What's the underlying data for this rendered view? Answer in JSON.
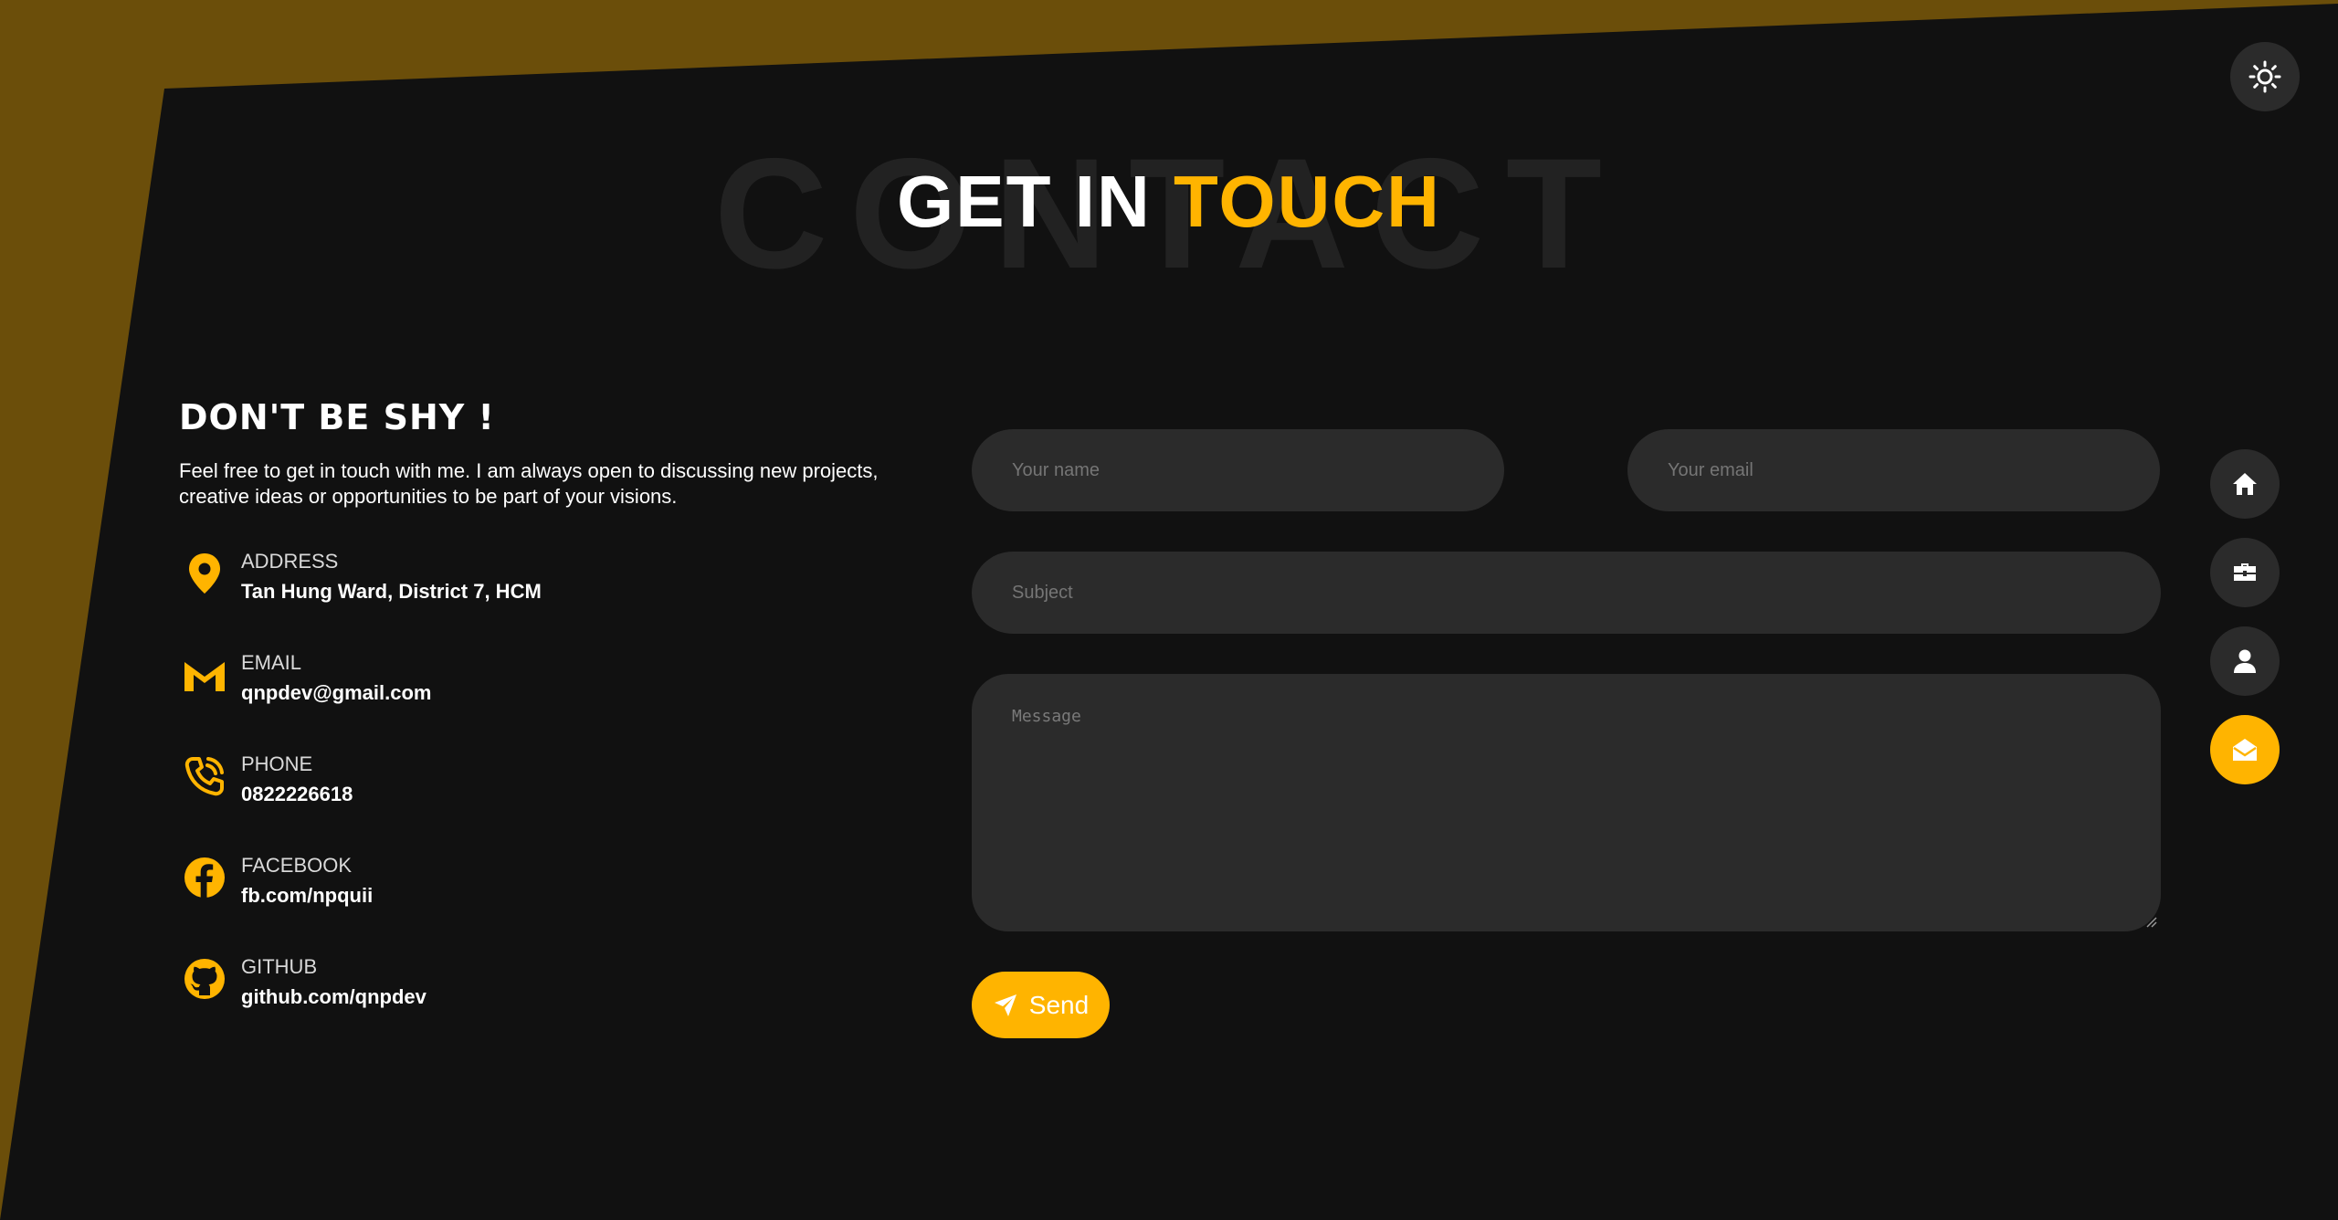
{
  "colors": {
    "accent": "#ffb400",
    "background": "#111111",
    "accent_band": "#6b4e0a",
    "field_bg": "#2b2b2b"
  },
  "header": {
    "background_word": "CONTACT",
    "title_part1": "GET IN",
    "title_part2": "TOUCH"
  },
  "intro": {
    "title": "DON'T BE SHY !",
    "description": "Feel free to get in touch with me. I am always open to discussing new projects, creative ideas or opportunities to be part of your visions."
  },
  "contact_info": [
    {
      "icon": "map-pin-icon",
      "label": "ADDRESS",
      "value": "Tan Hung Ward, District 7, HCM"
    },
    {
      "icon": "gmail-icon",
      "label": "EMAIL",
      "value": "qnpdev@gmail.com"
    },
    {
      "icon": "phone-icon",
      "label": "PHONE",
      "value": "0822226618"
    },
    {
      "icon": "facebook-icon",
      "label": "FACEBOOK",
      "value": "fb.com/npquii"
    },
    {
      "icon": "github-icon",
      "label": "GITHUB",
      "value": "github.com/qnpdev"
    }
  ],
  "form": {
    "name_placeholder": "Your name",
    "email_placeholder": "Your email",
    "subject_placeholder": "Subject",
    "message_placeholder": "Message",
    "send_label": "Send"
  },
  "nav": [
    {
      "icon": "home-icon",
      "active": false
    },
    {
      "icon": "briefcase-icon",
      "active": false
    },
    {
      "icon": "user-icon",
      "active": false
    },
    {
      "icon": "envelope-open-icon",
      "active": true
    }
  ],
  "theme_toggle": {
    "icon": "sun-icon"
  }
}
